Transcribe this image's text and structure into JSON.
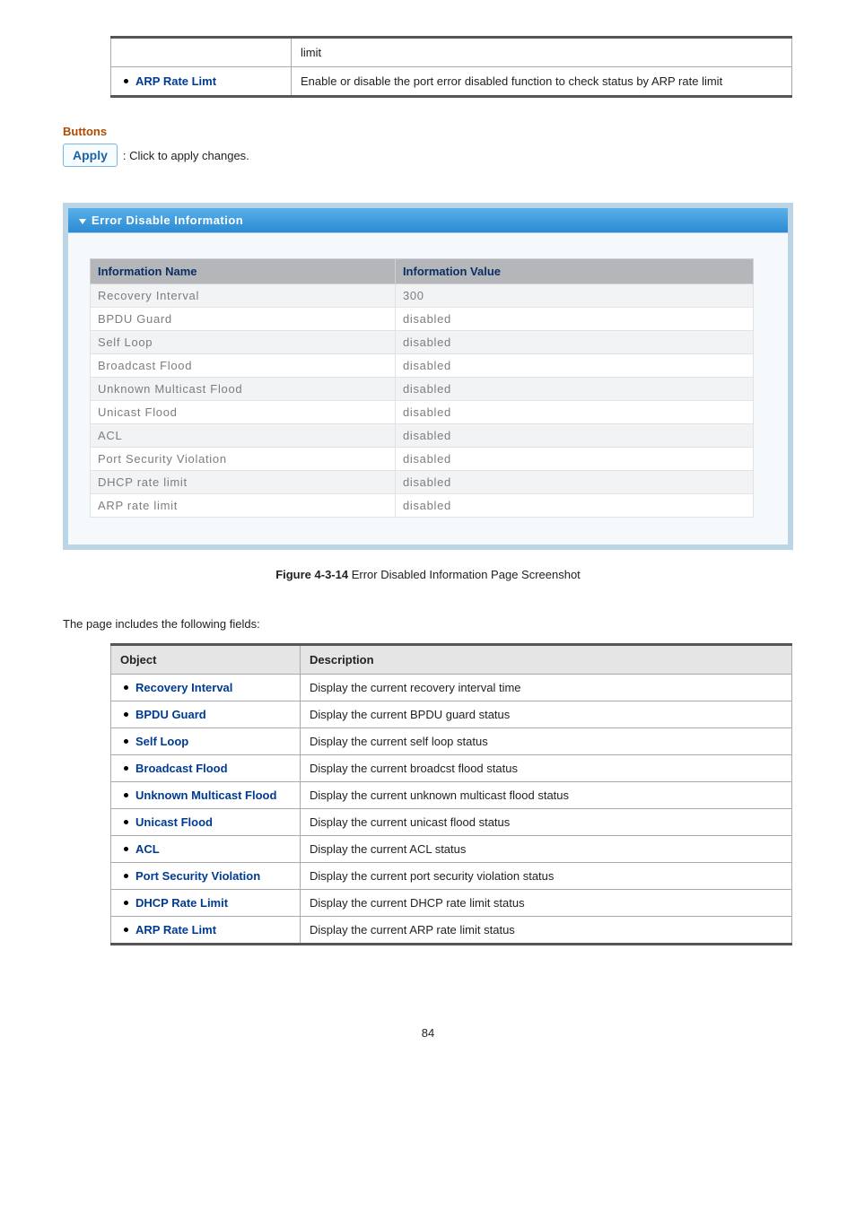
{
  "top_table": {
    "row1_right": "limit",
    "row2_left": "ARP Rate Limt",
    "row2_right": "Enable or disable the port error disabled function to check status by ARP rate limit"
  },
  "buttons": {
    "heading": "Buttons",
    "apply_label": "Apply",
    "apply_note": ": Click to apply changes."
  },
  "panel": {
    "title": "Error Disable Information",
    "header_name": "Information Name",
    "header_value": "Information Value",
    "rows": [
      {
        "name": "Recovery Interval",
        "value": "300"
      },
      {
        "name": "BPDU Guard",
        "value": "disabled"
      },
      {
        "name": "Self Loop",
        "value": "disabled"
      },
      {
        "name": "Broadcast Flood",
        "value": "disabled"
      },
      {
        "name": "Unknown Multicast Flood",
        "value": "disabled"
      },
      {
        "name": "Unicast Flood",
        "value": "disabled"
      },
      {
        "name": "ACL",
        "value": "disabled"
      },
      {
        "name": "Port Security Violation",
        "value": "disabled"
      },
      {
        "name": "DHCP rate limit",
        "value": "disabled"
      },
      {
        "name": "ARP rate limit",
        "value": "disabled"
      }
    ]
  },
  "figure": {
    "num": "Figure 4-3-14",
    "caption": " Error Disabled Information Page Screenshot"
  },
  "intro": "The page includes the following fields:",
  "desc": {
    "header_obj": "Object",
    "header_desc": "Description",
    "rows": [
      {
        "obj": "Recovery Interval",
        "desc": "Display the current recovery interval time"
      },
      {
        "obj": "BPDU Guard",
        "desc": "Display the current BPDU guard status"
      },
      {
        "obj": "Self Loop",
        "desc": "Display the current self loop status"
      },
      {
        "obj": "Broadcast Flood",
        "desc": "Display the current broadcst flood status"
      },
      {
        "obj": "Unknown Multicast Flood",
        "desc": "Display the current unknown multicast flood status"
      },
      {
        "obj": "Unicast Flood",
        "desc": "Display the current unicast flood status"
      },
      {
        "obj": "ACL",
        "desc": "Display the current ACL status"
      },
      {
        "obj": "Port Security Violation",
        "desc": "Display the current port security violation status"
      },
      {
        "obj": "DHCP Rate Limit",
        "desc": "Display the current DHCP rate limit status"
      },
      {
        "obj": "ARP Rate Limt",
        "desc": "Display the current ARP rate limit status"
      }
    ]
  },
  "page_number": "84"
}
